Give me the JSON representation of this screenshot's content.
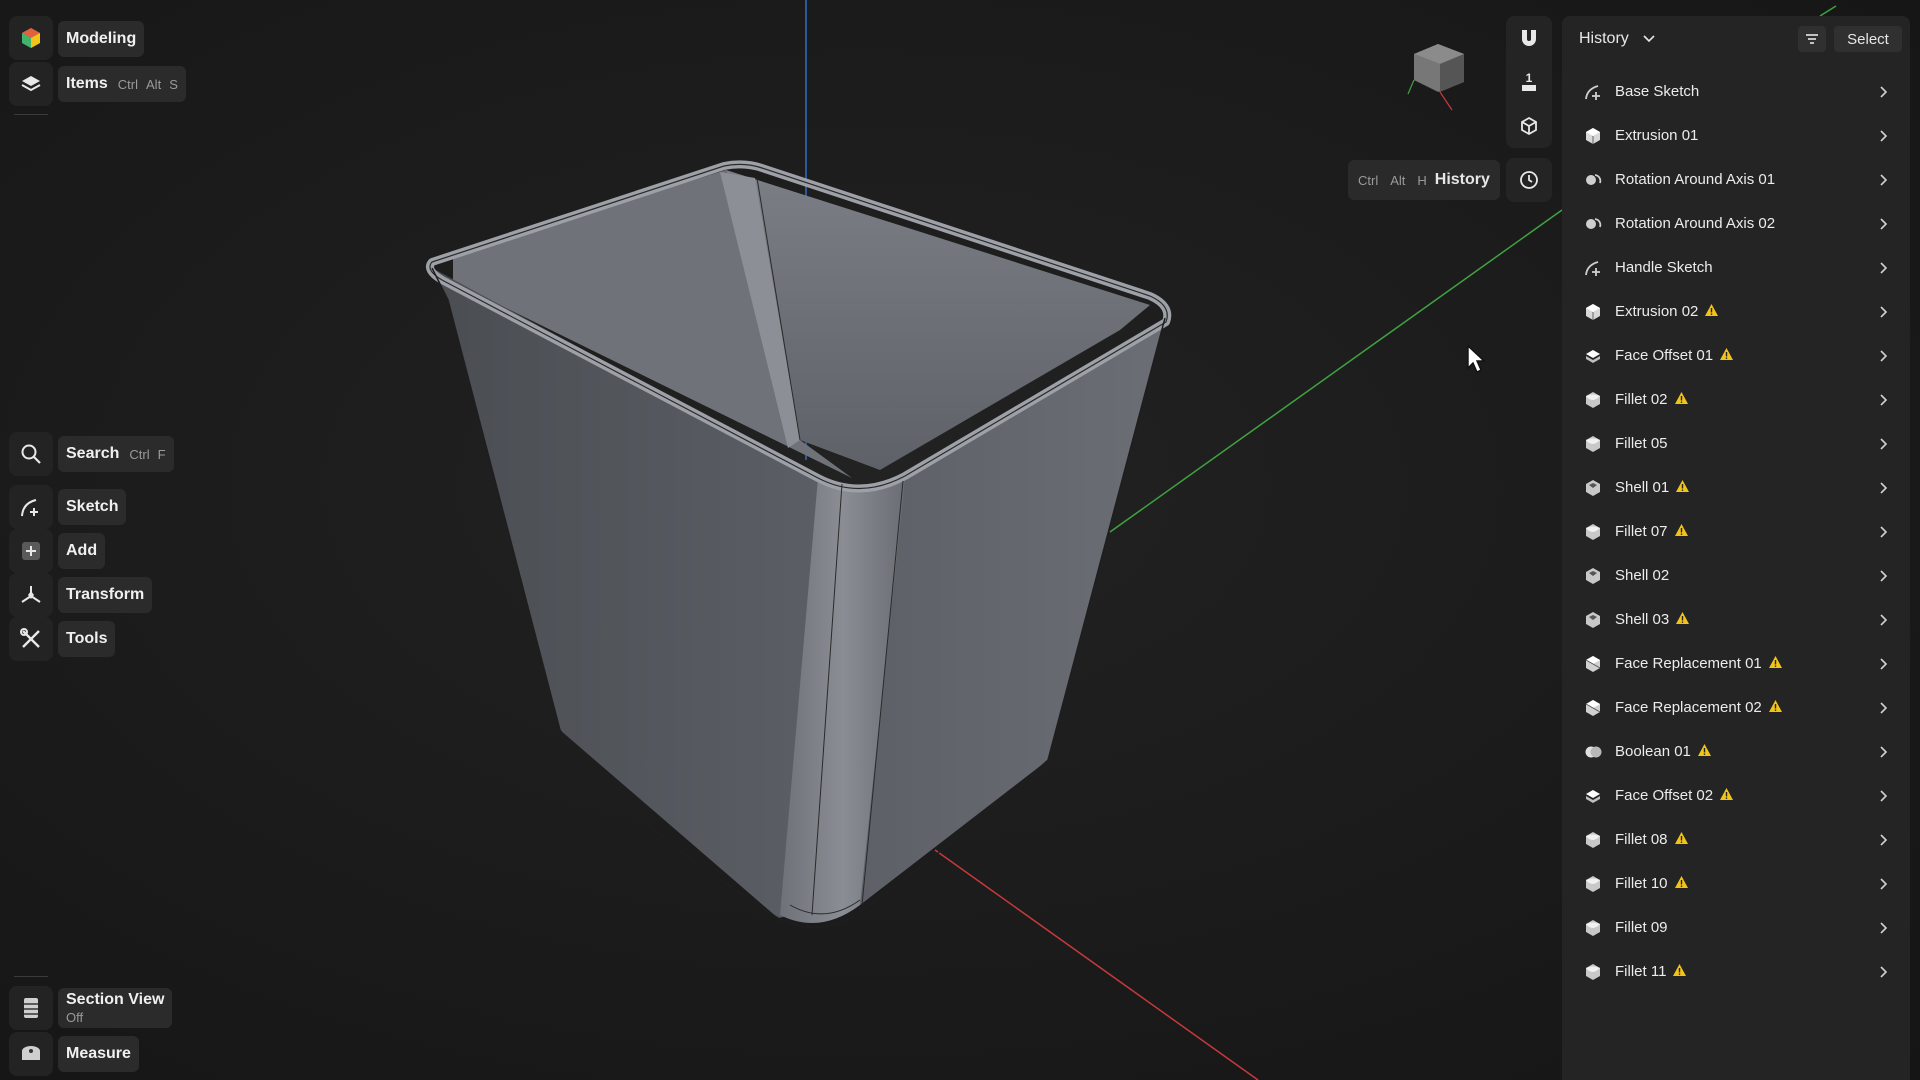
{
  "toolbar": {
    "modeling": "Modeling",
    "items": {
      "label": "Items",
      "k1": "Ctrl",
      "k2": "Alt",
      "k3": "S"
    },
    "search": {
      "label": "Search",
      "k1": "Ctrl",
      "k2": "F"
    },
    "sketch": "Sketch",
    "add": "Add",
    "transform": "Transform",
    "tools": "Tools",
    "section_view": {
      "label": "Section View",
      "state": "Off"
    },
    "measure": "Measure"
  },
  "viewport": {
    "history_shortcut": {
      "k1": "Ctrl",
      "k2": "Alt",
      "k3": "H",
      "label": "History"
    },
    "snap_value": "1"
  },
  "history_panel": {
    "title": "History",
    "select_label": "Select",
    "items": [
      {
        "label": "Base Sketch",
        "icon": "sketch-icon",
        "warning": false
      },
      {
        "label": "Extrusion 01",
        "icon": "extrusion-icon",
        "warning": false
      },
      {
        "label": "Rotation Around Axis 01",
        "icon": "rotation-icon",
        "warning": false
      },
      {
        "label": "Rotation Around Axis 02",
        "icon": "rotation-icon",
        "warning": false
      },
      {
        "label": "Handle Sketch",
        "icon": "sketch-icon",
        "warning": false
      },
      {
        "label": "Extrusion 02",
        "icon": "extrusion-icon",
        "warning": true
      },
      {
        "label": "Face Offset 01",
        "icon": "face-offset-icon",
        "warning": true
      },
      {
        "label": "Fillet 02",
        "icon": "fillet-icon",
        "warning": true
      },
      {
        "label": "Fillet 05",
        "icon": "fillet-icon",
        "warning": false
      },
      {
        "label": "Shell 01",
        "icon": "shell-icon",
        "warning": true
      },
      {
        "label": "Fillet 07",
        "icon": "fillet-icon",
        "warning": true
      },
      {
        "label": "Shell 02",
        "icon": "shell-icon",
        "warning": false
      },
      {
        "label": "Shell 03",
        "icon": "shell-icon",
        "warning": true
      },
      {
        "label": "Face Replacement 01",
        "icon": "face-replacement-icon",
        "warning": true
      },
      {
        "label": "Face Replacement 02",
        "icon": "face-replacement-icon",
        "warning": true
      },
      {
        "label": "Boolean 01",
        "icon": "boolean-icon",
        "warning": true
      },
      {
        "label": "Face Offset 02",
        "icon": "face-offset-icon",
        "warning": true
      },
      {
        "label": "Fillet 08",
        "icon": "fillet-icon",
        "warning": true
      },
      {
        "label": "Fillet 10",
        "icon": "fillet-icon",
        "warning": true
      },
      {
        "label": "Fillet 09",
        "icon": "fillet-icon",
        "warning": false
      },
      {
        "label": "Fillet 11",
        "icon": "fillet-icon",
        "warning": true
      }
    ]
  },
  "colors": {
    "background": "#1a1a1a",
    "panel": "#242424",
    "warning": "#f2c418",
    "axis_x": "#c8393b",
    "axis_y": "#3fa33f",
    "axis_z": "#2f6fc4"
  }
}
